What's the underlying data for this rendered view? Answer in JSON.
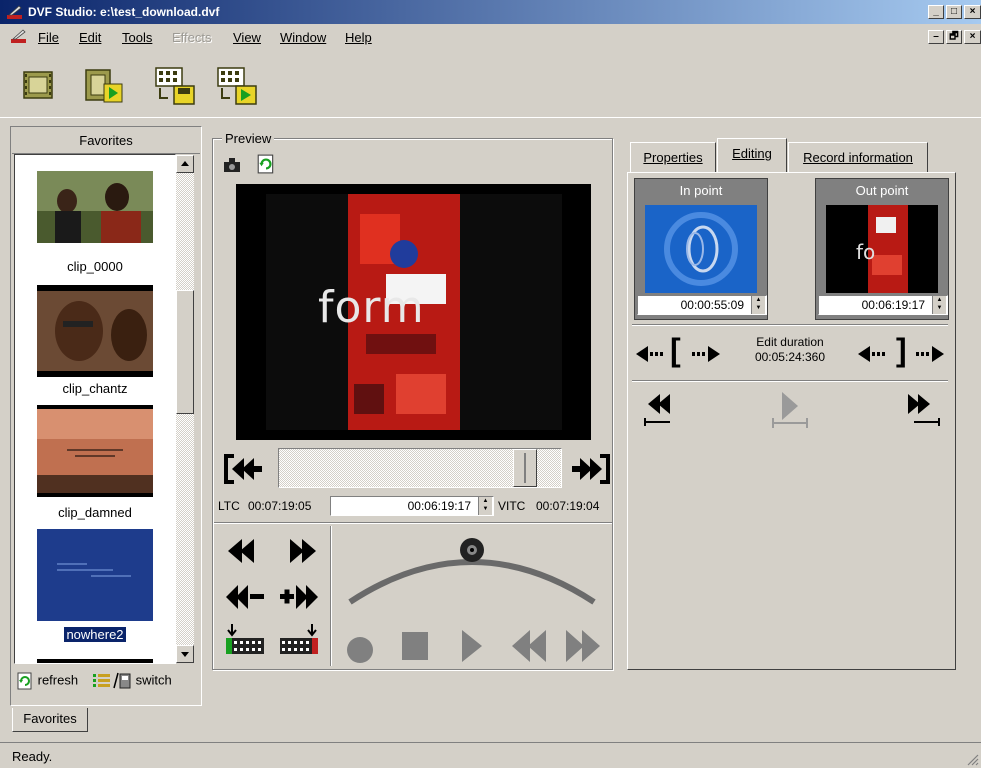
{
  "window": {
    "title": "DVF Studio: e:\\test_download.dvf",
    "btn_minimize": "_",
    "btn_maximize": "□",
    "btn_close": "×",
    "mdi_minimize": "–",
    "mdi_restore": "🗗",
    "mdi_close": "×"
  },
  "menu": {
    "items": [
      {
        "label": "File",
        "enabled": true
      },
      {
        "label": "Edit",
        "enabled": true
      },
      {
        "label": "Tools",
        "enabled": true
      },
      {
        "label": "Effects",
        "enabled": false
      },
      {
        "label": "View",
        "enabled": true
      },
      {
        "label": "Window",
        "enabled": true
      },
      {
        "label": "Help",
        "enabled": true
      }
    ]
  },
  "toolbar": {
    "buttons": [
      "film-strip-icon",
      "film-play-icon",
      "film-save-icon",
      "film-export-play-icon"
    ]
  },
  "favorites": {
    "header": "Favorites",
    "clips": [
      {
        "label": "clip_0000",
        "selected": false,
        "thumb_color": "#5a6a3a"
      },
      {
        "label": "clip_chantz",
        "selected": false,
        "thumb_color": "#6b3d25"
      },
      {
        "label": "clip_damned",
        "selected": false,
        "thumb_color": "#b05a40"
      },
      {
        "label": "nowhere2",
        "selected": true,
        "thumb_color": "#1e3c8c"
      }
    ],
    "refresh_label": "refresh",
    "switch_label": "switch",
    "tab_label": "Favorites"
  },
  "preview": {
    "group_label": "Preview",
    "video_text": "form",
    "ltc_label": "LTC",
    "ltc_value": "00:07:19:05",
    "timecode_value": "00:06:19:17",
    "vitc_label": "VITC",
    "vitc_value": "00:07:19:04"
  },
  "tabs": {
    "items": [
      {
        "label": "Properties",
        "active": false
      },
      {
        "label": "Editing",
        "active": true
      },
      {
        "label": "Record information",
        "active": false
      }
    ]
  },
  "editing": {
    "in_point_label": "In point",
    "in_point_value": "00:00:55:09",
    "out_point_label": "Out point",
    "out_point_value": "00:06:19:17",
    "edit_duration_label": "Edit duration",
    "edit_duration_value": "00:05:24:360",
    "bracket_open": "[",
    "bracket_close": "]"
  },
  "status": {
    "text": "Ready."
  }
}
